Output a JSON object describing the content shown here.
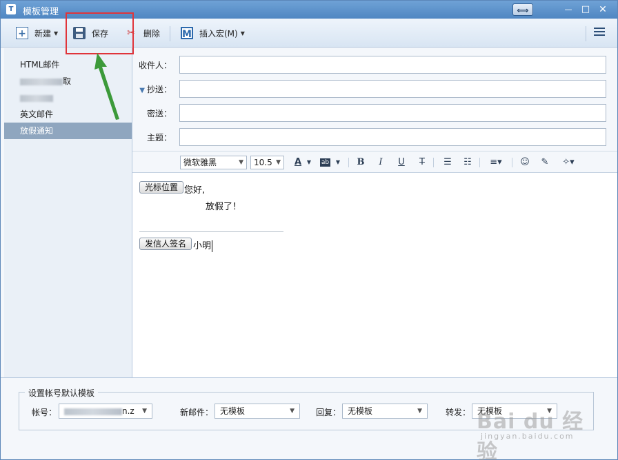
{
  "window": {
    "title": "模板管理",
    "restore_glyph": "⟺",
    "minimize_glyph": "—",
    "maximize_glyph": "□",
    "close_glyph": "✕"
  },
  "toolbar": {
    "new_label": "新建",
    "save_label": "保存",
    "delete_label": "删除",
    "insert_macro_label": "插入宏(M)",
    "new_icon": "plus-box-icon",
    "save_icon": "floppy-disk-icon",
    "delete_icon": "scissors-icon",
    "macro_icon": "letter-m-icon",
    "view_icon": "list-view-icon"
  },
  "templates": [
    {
      "label": "HTML邮件",
      "selected": false,
      "obscured": false
    },
    {
      "label": "取",
      "selected": false,
      "obscured": true
    },
    {
      "label": "",
      "selected": false,
      "obscured": true
    },
    {
      "label": "英文邮件",
      "selected": false,
      "obscured": false
    },
    {
      "label": "放假通知",
      "selected": true,
      "obscured": false
    }
  ],
  "fields": {
    "to_label": "收件人：",
    "cc_label": "抄送：",
    "bcc_label": "密送：",
    "subject_label": "主题：",
    "to_value": "",
    "cc_value": "",
    "bcc_value": "",
    "subject_value": ""
  },
  "format": {
    "font_family": "微软雅黑",
    "font_size": "10.5",
    "bold": "B",
    "italic": "I",
    "underline": "U",
    "strike": "T"
  },
  "editor": {
    "cursor_macro": "光标位置",
    "greeting": "您好,",
    "body": "放假了！",
    "signature_macro": "发信人签名",
    "signature": "小明"
  },
  "defaults": {
    "group_title": "设置帐号默认模板",
    "account_label": "帐号：",
    "account_value_visible": "n.z",
    "new_mail_label": "新邮件：",
    "new_mail_value": "无模板",
    "reply_label": "回复：",
    "reply_value": "无模板",
    "forward_label": "转发：",
    "forward_value": "无模板"
  },
  "watermark": {
    "main": "Bai du 经验",
    "sub": "jingyan.baidu.com"
  },
  "colors": {
    "accent": "#4f86c2",
    "selected_item": "#8fa6bf",
    "annotation": "#e0343a",
    "arrow": "#3c9a3a"
  }
}
